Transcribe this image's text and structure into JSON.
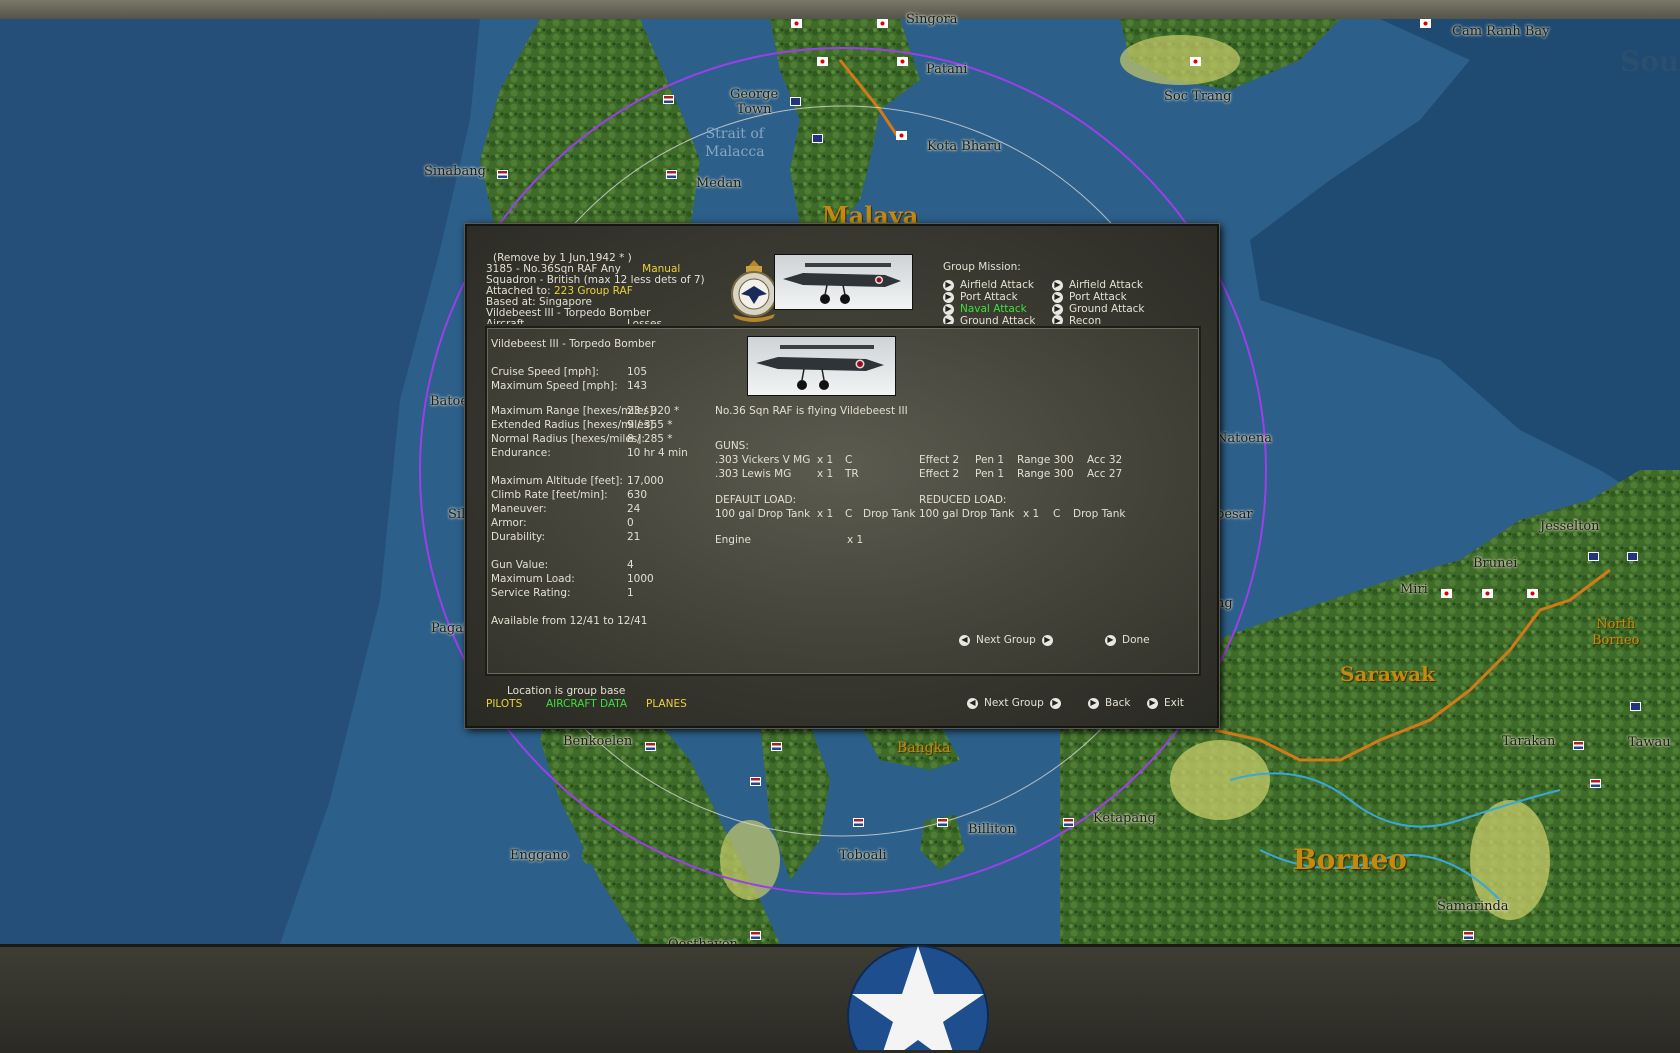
{
  "map": {
    "places": {
      "singora": "Singora",
      "patani": "Patani",
      "george_town": "George\nTown",
      "strait": "Strait of\nMalacca",
      "kota_bharu": "Kota Bharu",
      "sinabang": "Sinabang",
      "medan": "Medan",
      "malaya": "Malaya",
      "cam_ranh": "Cam Ranh Bay",
      "soc_trang": "Soc Trang",
      "sou": "Sou",
      "batoe": "Batoe",
      "sil": "Sil",
      "pagai": "Pagai",
      "natoena": "Natoena",
      "besar": "besar",
      "ng": "ng",
      "jesselton": "Jesselton",
      "brunei": "Brunei",
      "miri": "Miri",
      "north_borneo": "North\nBorneo",
      "sarawak": "Sarawak",
      "benkoelen": "Benkoelen",
      "bangka": "Bangka",
      "tarakan": "Tarakan",
      "tawau": "Tawau",
      "billiton": "Billiton",
      "ketapang": "Ketapang",
      "enggano": "Enggano",
      "toboali": "Toboali",
      "borneo": "Borneo",
      "samarinda": "Samarinda",
      "oosthaven": "Oosthaven"
    }
  },
  "dialog": {
    "header": {
      "remove_by": "(Remove by  1 Jun,1942 * )",
      "unit_line": "3185 - No.36Sqn RAF  Any",
      "manual": "Manual",
      "squadron_line": "Squadron - British (max 12 less dets of 7)",
      "attached_prefix": "Attached to:",
      "attached_value": "223 Group RAF",
      "based_at": "Based at: Singapore",
      "aircraft_type": "Vildebeest III - Torpedo Bomber",
      "cut_aircraft": "Aircraft",
      "cut_losses": "Losses"
    },
    "group_mission": {
      "title": "Group Mission:",
      "left": [
        "Airfield Attack",
        "Port Attack",
        "Naval Attack",
        "Ground Attack"
      ],
      "right": [
        "Airfield Attack",
        "Port Attack",
        "Ground Attack",
        "Recon"
      ]
    },
    "specs": {
      "title": "Vildebeest III - Torpedo Bomber",
      "rows": [
        {
          "label": "Cruise Speed [mph]:",
          "value": "105"
        },
        {
          "label": "Maximum Speed [mph]:",
          "value": "143"
        },
        {
          "label": "Maximum Range [hexes/miles]:",
          "value": "23 / 920 *"
        },
        {
          "label": "Extended Radius [hexes/miles]:",
          "value": "9 / 355 *"
        },
        {
          "label": "Normal Radius [hexes/miles]:",
          "value": "8 / 285 *"
        },
        {
          "label": "Endurance:",
          "value": "10 hr  4 min"
        },
        {
          "label": "Maximum Altitude [feet]:",
          "value": "17,000"
        },
        {
          "label": "Climb Rate [feet/min]:",
          "value": "630"
        },
        {
          "label": "Maneuver:",
          "value": "24"
        },
        {
          "label": "Armor:",
          "value": "0"
        },
        {
          "label": "Durability:",
          "value": "21"
        },
        {
          "label": "Gun Value:",
          "value": "4"
        },
        {
          "label": "Maximum Load:",
          "value": "1000"
        },
        {
          "label": "Service Rating:",
          "value": "1"
        }
      ],
      "available": "Available from  12/41 to 12/41"
    },
    "flying": "No.36 Sqn RAF is flying Vildebeest III",
    "guns": {
      "title": "GUNS:",
      "rows": [
        {
          "name": ".303 Vickers V MG",
          "count": "x 1",
          "facing": "C",
          "effect": "Effect 2",
          "pen": "Pen 1",
          "range": "Range 300",
          "acc": "Acc 32"
        },
        {
          "name": ".303 Lewis MG",
          "count": "x 1",
          "facing": "TR",
          "effect": "Effect 2",
          "pen": "Pen 1",
          "range": "Range 300",
          "acc": "Acc 27"
        }
      ]
    },
    "default_load": {
      "title": "DEFAULT LOAD:",
      "item": "100 gal Drop Tank",
      "count": "x 1",
      "facing": "C",
      "type": "Drop Tank"
    },
    "reduced_load": {
      "title": "REDUCED LOAD:",
      "item": "100 gal Drop Tank",
      "count": "x 1",
      "facing": "C",
      "type": "Drop Tank"
    },
    "engine": {
      "label": "Engine",
      "count": "x 1"
    },
    "inner_buttons": {
      "next_group": "Next Group",
      "done": "Done"
    },
    "footer": {
      "location": "Location is group base",
      "pilots": "PILOTS",
      "aircraft_data": "AIRCRAFT DATA",
      "planes": "PLANES",
      "next_group": "Next Group",
      "back": "Back",
      "exit": "Exit"
    }
  },
  "colors": {
    "sea": "#2c5f8a",
    "deep_sea": "#1f4a72",
    "land": "#3f6b2a",
    "highlight_yellow": "#ecd23a",
    "highlight_green": "#3ce03c",
    "range_circle": "#9a40e8",
    "border_orange": "#d07a18"
  }
}
